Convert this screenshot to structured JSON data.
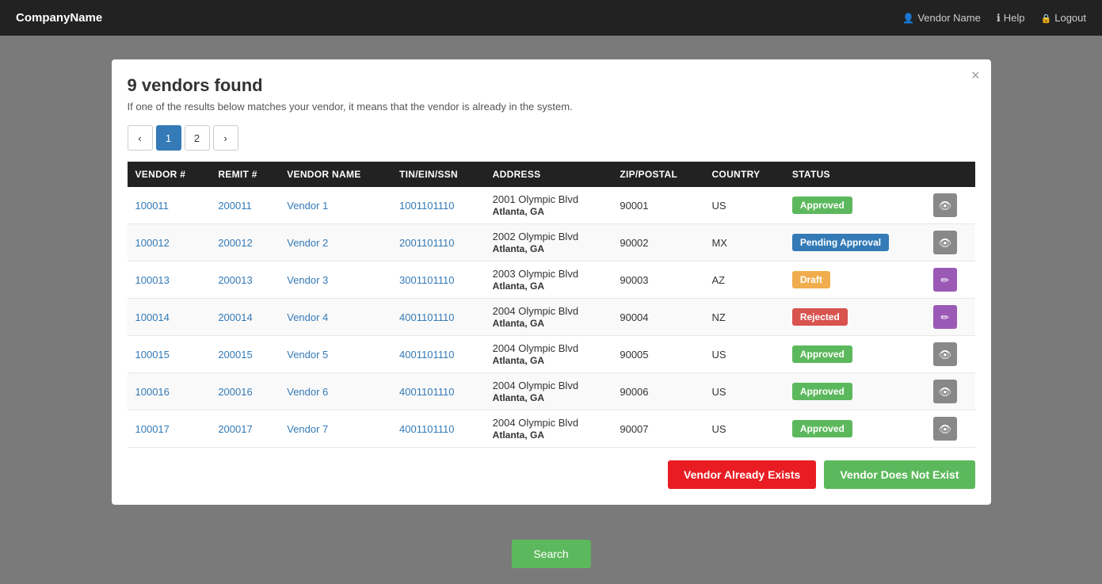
{
  "navbar": {
    "brand": "CompanyName",
    "vendor_name": "Vendor Name",
    "help": "Help",
    "logout": "Logout"
  },
  "modal": {
    "title": "9 vendors found",
    "subtitle_text": "If one of the results below matches your vendor, it means that the vendor is already in the system.",
    "close_label": "×",
    "pagination": {
      "prev": "‹",
      "next": "›",
      "pages": [
        "1",
        "2"
      ],
      "active_page": "1"
    },
    "table": {
      "headers": [
        "VENDOR #",
        "REMIT #",
        "VENDOR NAME",
        "TIN/EIN/SSN",
        "ADDRESS",
        "ZIP/POSTAL",
        "COUNTRY",
        "STATUS",
        ""
      ],
      "rows": [
        {
          "vendor_num": "100011",
          "remit_num": "200011",
          "vendor_name": "Vendor 1",
          "tin": "1001101110",
          "addr1": "2001 Olympic Blvd",
          "addr2": "Atlanta, GA",
          "zip": "90001",
          "country": "US",
          "status": "Approved",
          "status_class": "badge-approved",
          "action": "eye"
        },
        {
          "vendor_num": "100012",
          "remit_num": "200012",
          "vendor_name": "Vendor 2",
          "tin": "2001101110",
          "addr1": "2002 Olympic Blvd",
          "addr2": "Atlanta, GA",
          "zip": "90002",
          "country": "MX",
          "status": "Pending Approval",
          "status_class": "badge-pending",
          "action": "eye"
        },
        {
          "vendor_num": "100013",
          "remit_num": "200013",
          "vendor_name": "Vendor 3",
          "tin": "3001101110",
          "addr1": "2003 Olympic Blvd",
          "addr2": "Atlanta, GA",
          "zip": "90003",
          "country": "AZ",
          "status": "Draft",
          "status_class": "badge-draft",
          "action": "pencil"
        },
        {
          "vendor_num": "100014",
          "remit_num": "200014",
          "vendor_name": "Vendor 4",
          "tin": "4001101110",
          "addr1": "2004 Olympic Blvd",
          "addr2": "Atlanta, GA",
          "zip": "90004",
          "country": "NZ",
          "status": "Rejected",
          "status_class": "badge-rejected",
          "action": "pencil"
        },
        {
          "vendor_num": "100015",
          "remit_num": "200015",
          "vendor_name": "Vendor 5",
          "tin": "4001101110",
          "addr1": "2004 Olympic Blvd",
          "addr2": "Atlanta, GA",
          "zip": "90005",
          "country": "US",
          "status": "Approved",
          "status_class": "badge-approved",
          "action": "eye"
        },
        {
          "vendor_num": "100016",
          "remit_num": "200016",
          "vendor_name": "Vendor 6",
          "tin": "4001101110",
          "addr1": "2004 Olympic Blvd",
          "addr2": "Atlanta, GA",
          "zip": "90006",
          "country": "US",
          "status": "Approved",
          "status_class": "badge-approved",
          "action": "eye"
        },
        {
          "vendor_num": "100017",
          "remit_num": "200017",
          "vendor_name": "Vendor 7",
          "tin": "4001101110",
          "addr1": "2004 Olympic Blvd",
          "addr2": "Atlanta, GA",
          "zip": "90007",
          "country": "US",
          "status": "Approved",
          "status_class": "badge-approved",
          "action": "eye"
        }
      ]
    },
    "footer": {
      "btn_exists": "Vendor Already Exists",
      "btn_not_exists": "Vendor Does Not Exist"
    }
  },
  "search_button": "Search"
}
